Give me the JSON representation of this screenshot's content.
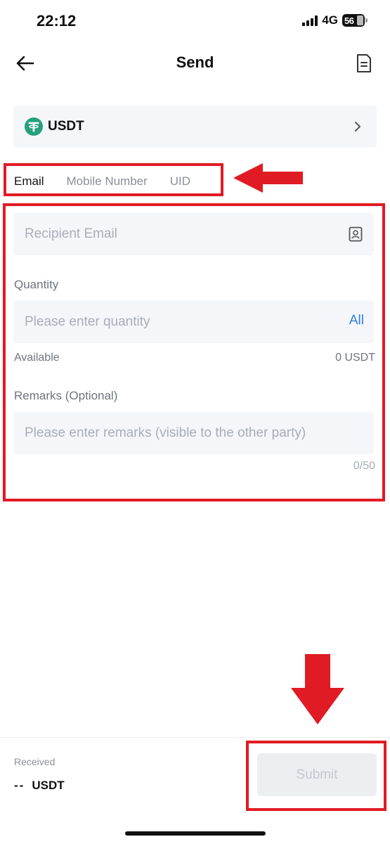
{
  "status_bar": {
    "time": "22:12",
    "network": "4G",
    "battery": "56"
  },
  "header": {
    "title": "Send",
    "back_icon": "arrow-left-icon",
    "history_icon": "document-icon"
  },
  "coin": {
    "name": "USDT",
    "logo_letter": "T",
    "logo_color": "#26a17b"
  },
  "tabs": [
    {
      "label": "Email",
      "active": true
    },
    {
      "label": "Mobile Number",
      "active": false
    },
    {
      "label": "UID",
      "active": false
    }
  ],
  "form": {
    "recipient_placeholder": "Recipient Email",
    "quantity_label": "Quantity",
    "quantity_placeholder": "Please enter quantity",
    "all_label": "All",
    "available_label": "Available",
    "available_value": "0 USDT",
    "remarks_label": "Remarks (Optional)",
    "remarks_placeholder": "Please enter remarks (visible to the other party)",
    "remarks_counter": "0/50"
  },
  "footer": {
    "received_label": "Received",
    "received_amount": "--",
    "received_unit": "USDT",
    "submit_label": "Submit"
  },
  "colors": {
    "annotation": "#e01b24",
    "accent": "#2f7de1",
    "field_bg": "#f4f6fa"
  }
}
